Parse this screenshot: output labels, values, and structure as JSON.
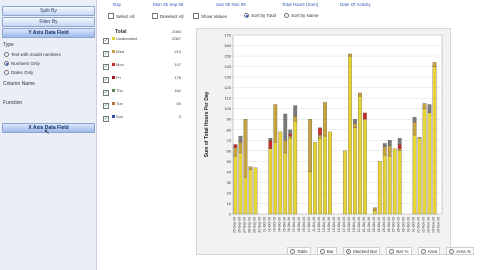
{
  "left": {
    "buttons": [
      "Split By",
      "Filter By",
      "Y Axis Data Field"
    ],
    "type_label": "Type",
    "radios": [
      {
        "label": "Text with model numbers",
        "selected": false
      },
      {
        "label": "Numbers Only",
        "selected": true
      },
      {
        "label": "Dates Only",
        "selected": false
      }
    ],
    "column_name_label": "Column Name",
    "function_label": "Function",
    "x_axis_button": "X Axis Data Field"
  },
  "header": {
    "day": "Day",
    "date": "Mon 25 Sep 06",
    "date2": "Sun 05 Nov 06",
    "total_hours": "Total Hours (Sum)",
    "date_activity": "Date Of Activity"
  },
  "controls": {
    "select_all": "Select All",
    "deselect_all": "Deselect All",
    "show_values": "Show Values",
    "sort_by_total": "Sort by Total",
    "sort_by_name": "Sort by Name",
    "show_values_checked": false,
    "sort_selected": "total"
  },
  "legend": {
    "title": "Total",
    "total": "2084",
    "items": [
      {
        "name": "Unallocated",
        "value": "2087",
        "color": "#e8d534"
      },
      {
        "name": "Wed",
        "value": "210",
        "color": "#c8a23a"
      },
      {
        "name": "Mon",
        "value": "147",
        "color": "#c92a2a"
      },
      {
        "name": "Fri",
        "value": "176",
        "color": "#a01a1a"
      },
      {
        "name": "Thu",
        "value": "162",
        "color": "#5a8a4a"
      },
      {
        "name": "Tue",
        "value": "69",
        "color": "#b07040"
      },
      {
        "name": "Sun",
        "value": "0",
        "color": "#3050a0"
      }
    ]
  },
  "chart_data": {
    "type": "bar",
    "stacked": true,
    "ylabel": "Sum of Total Hours Per Day",
    "ylim": [
      0,
      170
    ],
    "yticks": [
      0,
      10,
      20,
      30,
      40,
      50,
      60,
      70,
      80,
      90,
      100,
      110,
      120,
      130,
      140,
      150,
      160,
      170
    ],
    "categories": [
      "25-Sep-06",
      "26-Sep-06",
      "27-Sep-06",
      "28-Sep-06",
      "29-Sep-06",
      "30-Sep-06",
      "01-Oct-06",
      "02-Oct-06",
      "03-Oct-06",
      "04-Oct-06",
      "05-Oct-06",
      "06-Oct-06",
      "07-Oct-06",
      "08-Oct-06",
      "09-Oct-06",
      "10-Oct-06",
      "11-Oct-06",
      "12-Oct-06",
      "13-Oct-06",
      "14-Oct-06",
      "15-Oct-06",
      "16-Oct-06",
      "17-Oct-06",
      "18-Oct-06",
      "19-Oct-06",
      "20-Oct-06",
      "21-Oct-06",
      "22-Oct-06",
      "23-Oct-06",
      "24-Oct-06",
      "25-Oct-06",
      "26-Oct-06",
      "27-Oct-06",
      "28-Oct-06",
      "29-Oct-06",
      "30-Oct-06",
      "31-Oct-06",
      "01-Nov-06",
      "02-Nov-06",
      "03-Nov-06",
      "04-Nov-06",
      "05-Nov-06"
    ],
    "series": [
      {
        "name": "Unallocated",
        "color": "#e8d534",
        "values": [
          55,
          58,
          35,
          42,
          44,
          0,
          0,
          62,
          68,
          78,
          58,
          72,
          88,
          0,
          0,
          40,
          68,
          72,
          74,
          78,
          0,
          0,
          60,
          150,
          82,
          112,
          90,
          0,
          3,
          50,
          56,
          55,
          62,
          60,
          0,
          0,
          75,
          72,
          100,
          96,
          140,
          0
        ]
      },
      {
        "name": "Wed",
        "color": "#c8a23a",
        "values": [
          8,
          10,
          55,
          3,
          0,
          0,
          0,
          0,
          36,
          0,
          12,
          2,
          5,
          0,
          0,
          50,
          0,
          3,
          32,
          0,
          0,
          0,
          0,
          2,
          4,
          3,
          0,
          0,
          3,
          0,
          8,
          10,
          0,
          2,
          0,
          0,
          12,
          1,
          5,
          0,
          4,
          0
        ]
      },
      {
        "name": "Mon",
        "color": "#c92a2a",
        "values": [
          3,
          0,
          0,
          0,
          0,
          0,
          0,
          8,
          0,
          0,
          0,
          2,
          0,
          0,
          0,
          0,
          0,
          7,
          0,
          0,
          0,
          0,
          0,
          0,
          0,
          0,
          6,
          0,
          0,
          0,
          0,
          0,
          0,
          4,
          0,
          0,
          0,
          0,
          0,
          0,
          0,
          0
        ]
      },
      {
        "name": "Thu",
        "color": "#7a7a7a",
        "values": [
          0,
          6,
          0,
          0,
          0,
          0,
          0,
          2,
          0,
          0,
          25,
          4,
          10,
          0,
          0,
          0,
          0,
          0,
          0,
          0,
          0,
          0,
          0,
          0,
          4,
          0,
          0,
          0,
          0,
          0,
          3,
          5,
          0,
          6,
          0,
          0,
          5,
          0,
          0,
          8,
          0,
          0
        ]
      }
    ]
  },
  "bottom_options": [
    {
      "label": "Table",
      "selected": false
    },
    {
      "label": "Bar",
      "selected": false
    },
    {
      "label": "Stacked Bar",
      "selected": true
    },
    {
      "label": "Bar %",
      "selected": false
    },
    {
      "label": "Area",
      "selected": false
    },
    {
      "label": "Area %",
      "selected": false
    }
  ]
}
